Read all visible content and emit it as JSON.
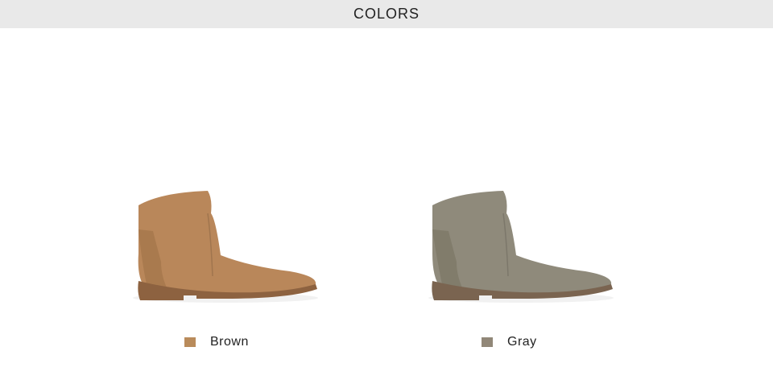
{
  "header": {
    "title": "COLORS"
  },
  "variants": [
    {
      "label": "Brown",
      "swatch_color": "#b98b5b",
      "boot_color": "#b9875a",
      "boot_shadow": "#9c6f45",
      "sole_color": "#8d6240",
      "icon": "ankle-boot-icon"
    },
    {
      "label": "Gray",
      "swatch_color": "#918778",
      "boot_color": "#8f8a7b",
      "boot_shadow": "#76715f",
      "sole_color": "#7a6450",
      "icon": "ankle-boot-icon"
    }
  ]
}
